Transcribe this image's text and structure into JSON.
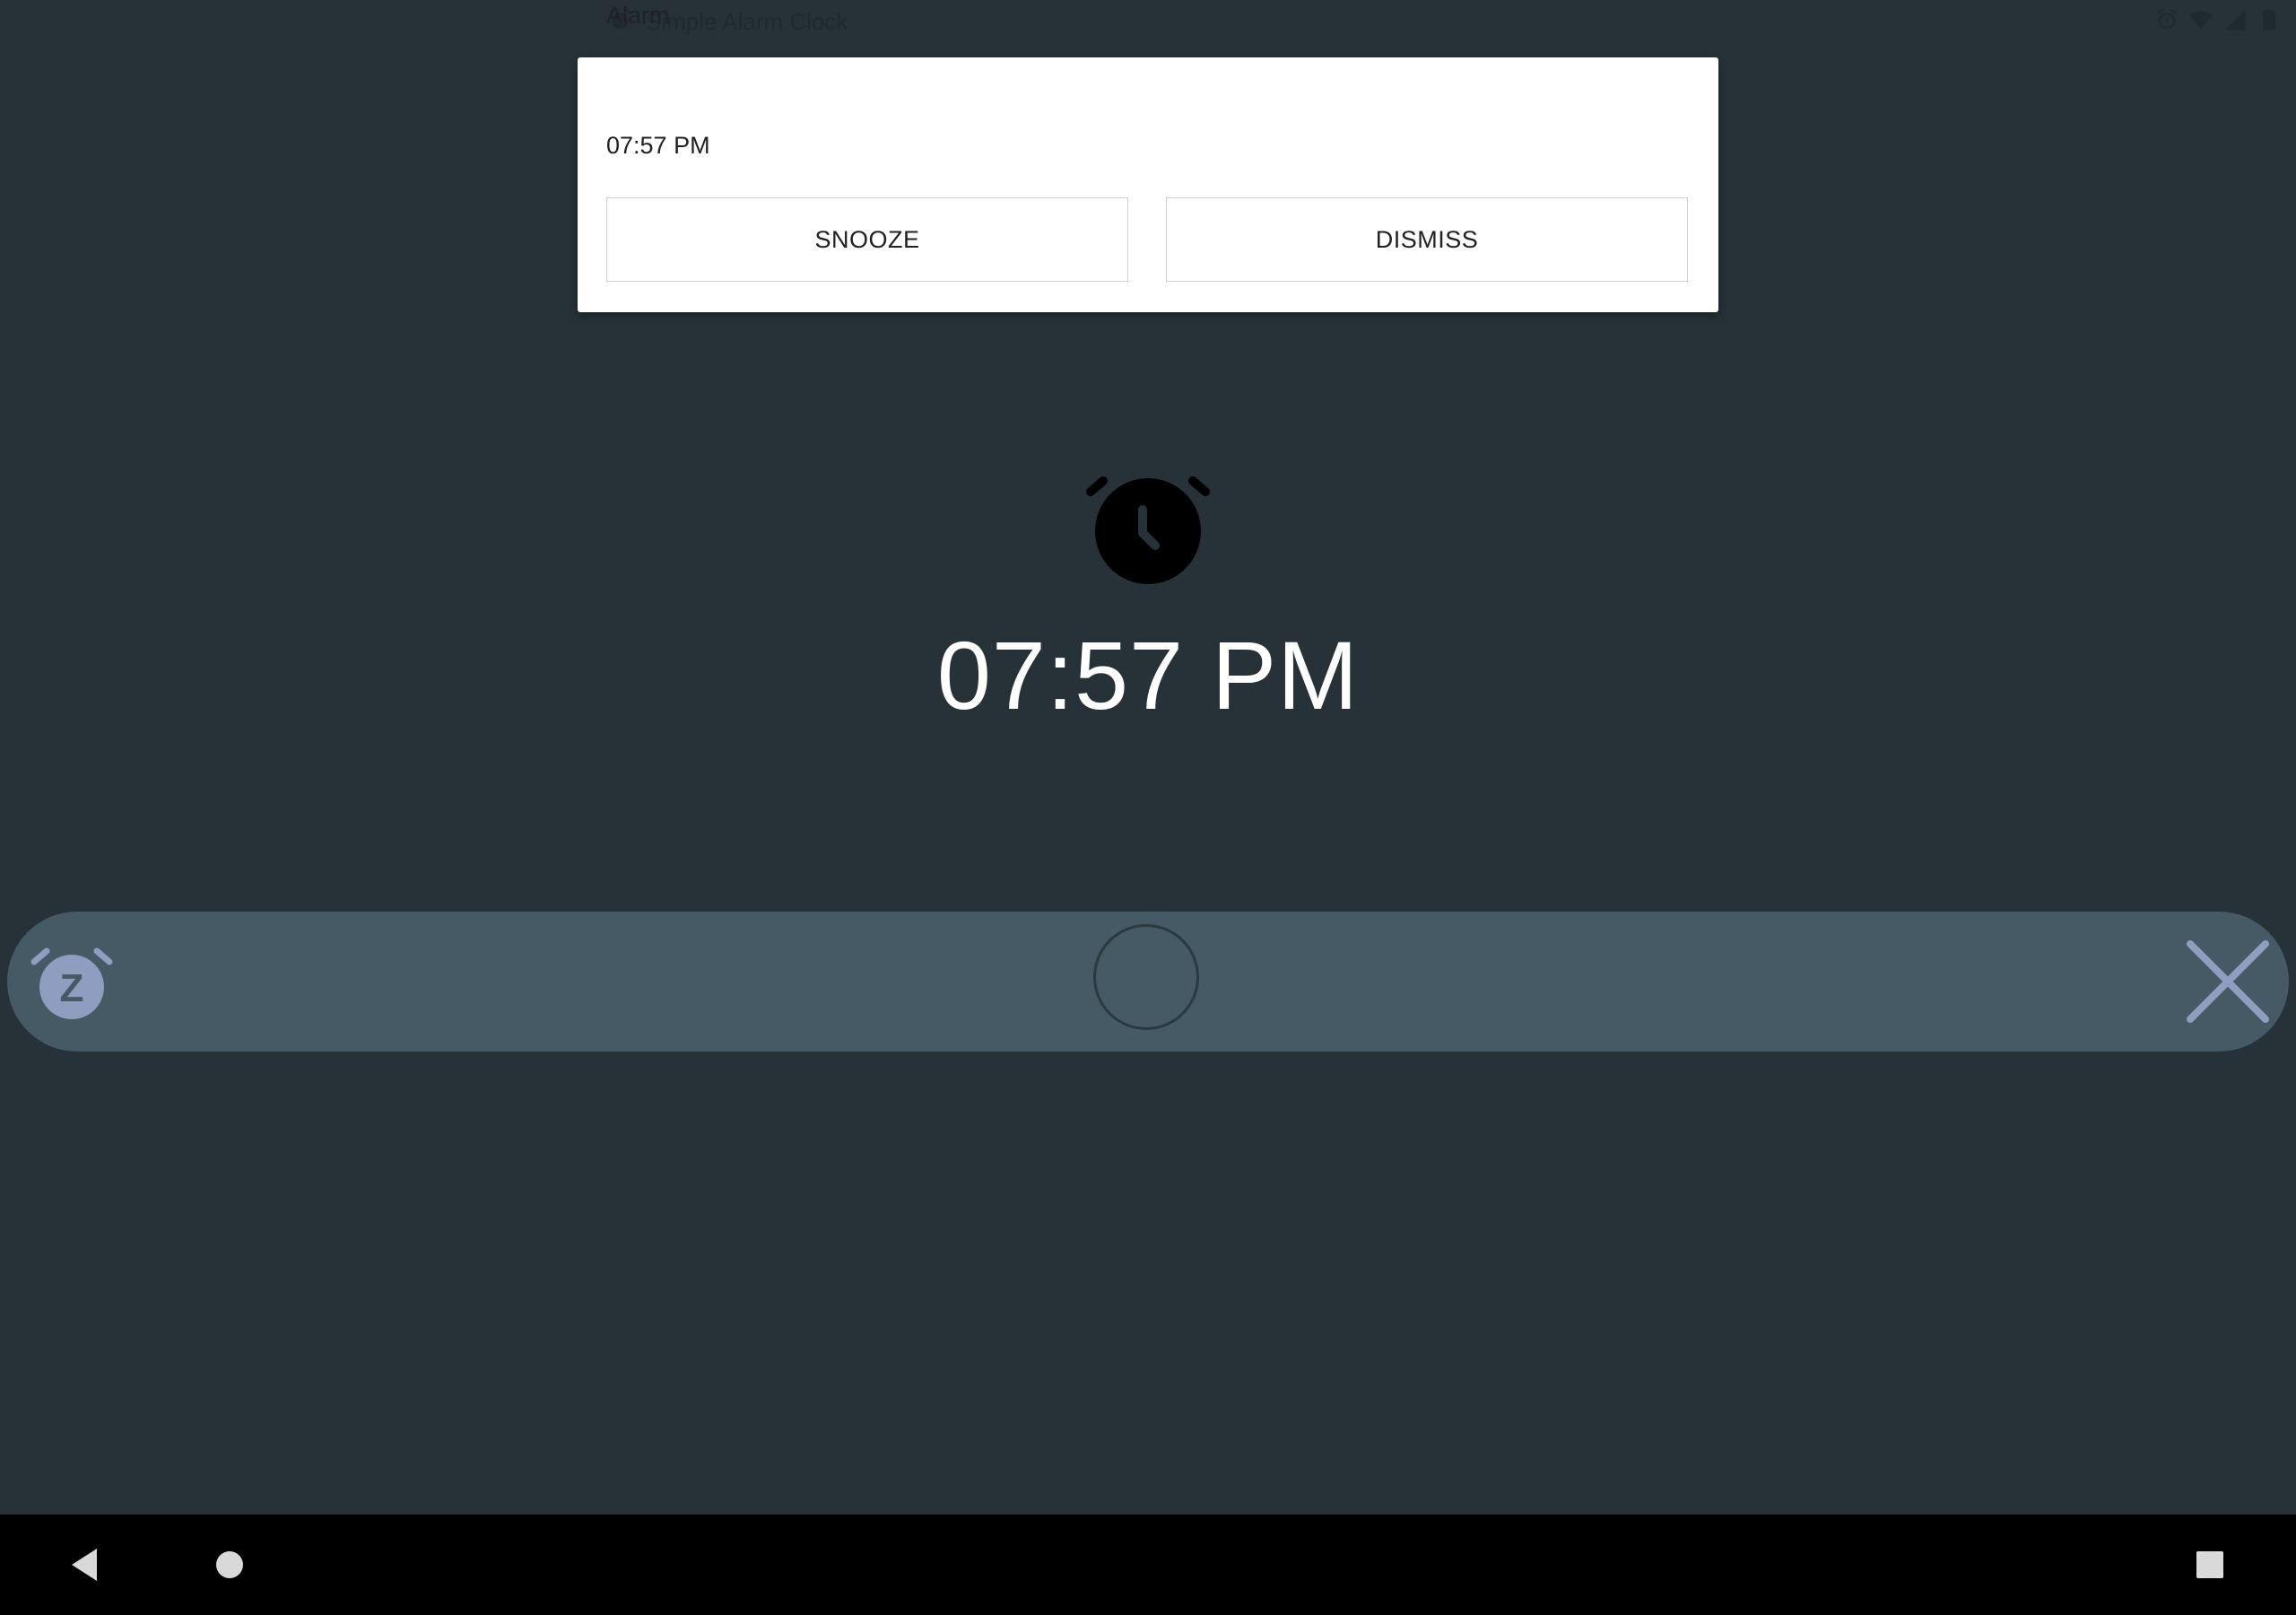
{
  "status_bar": {
    "app_title": "Simple Alarm Clock",
    "icons": [
      "alarm-icon",
      "wifi-icon",
      "cell-signal-icon",
      "battery-icon"
    ]
  },
  "notification": {
    "title": "Alarm",
    "time": "07:57 PM",
    "snooze_label": "SNOOZE",
    "dismiss_label": "DISMISS"
  },
  "alarm": {
    "time": "07:57 PM",
    "icon": "alarm-clock-icon"
  },
  "slider": {
    "left_icon": "snooze-icon",
    "left_letter": "Z",
    "right_icon": "close-icon"
  },
  "nav_bar": {
    "buttons": [
      "back",
      "home",
      "recents"
    ]
  },
  "colors": {
    "background": "#263238",
    "slider_track": "#455a64",
    "slider_icons": "#8f9dc0",
    "notification_bg": "#ffffff",
    "nav_bar": "#000000"
  }
}
